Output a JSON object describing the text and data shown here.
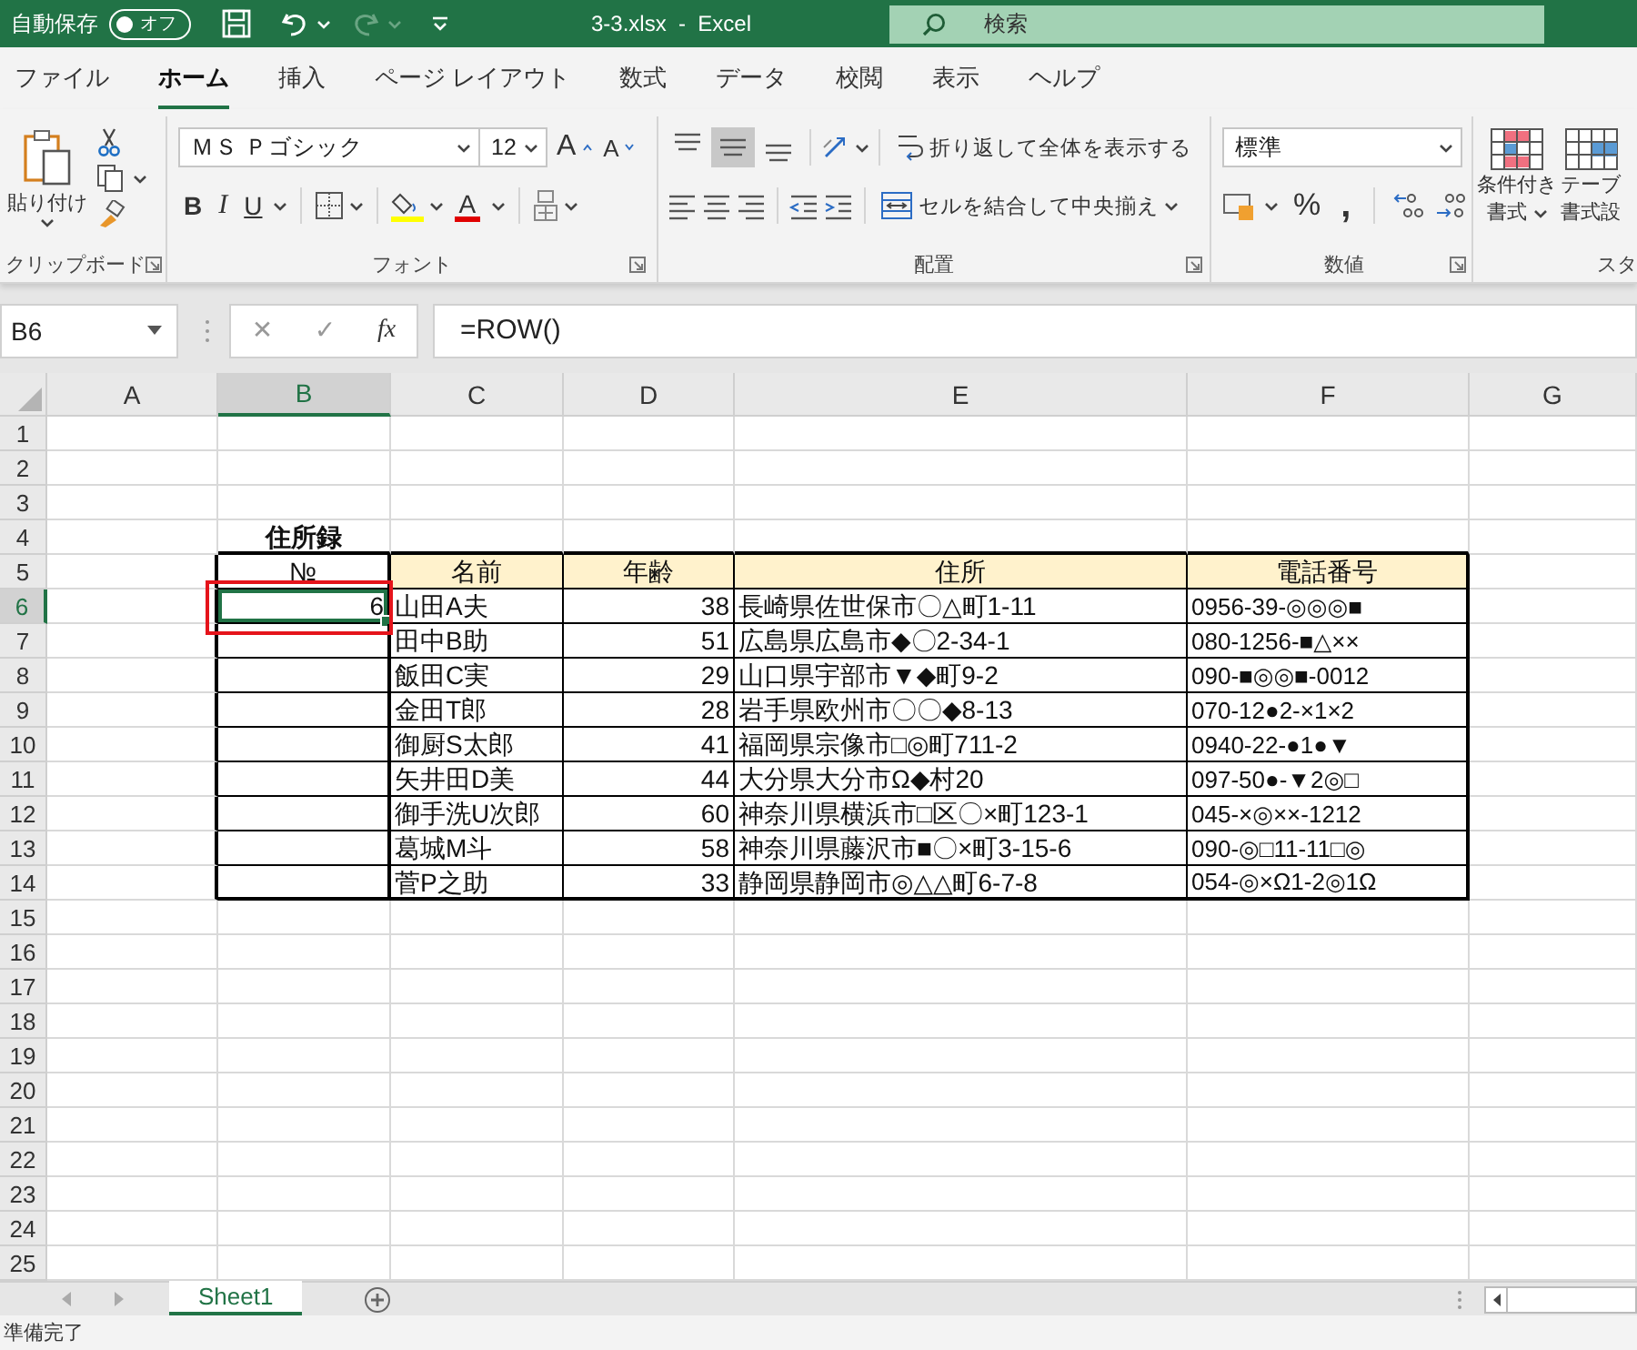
{
  "title_bar": {
    "autosave": {
      "label": "自動保存",
      "toggle": "オフ",
      "on": false
    },
    "title": "3-3.xlsx  -  Excel",
    "search": {
      "placeholder": "検索"
    }
  },
  "menu_tabs": [
    {
      "label": "ファイル",
      "selected": false
    },
    {
      "label": "ホーム",
      "selected": true
    },
    {
      "label": "挿入",
      "selected": false
    },
    {
      "label": "ページ レイアウト",
      "selected": false
    },
    {
      "label": "数式",
      "selected": false
    },
    {
      "label": "データ",
      "selected": false
    },
    {
      "label": "校閲",
      "selected": false
    },
    {
      "label": "表示",
      "selected": false
    },
    {
      "label": "ヘルプ",
      "selected": false
    }
  ],
  "ribbon": {
    "clipboard": {
      "paste": "貼り付け",
      "label": "クリップボード"
    },
    "font": {
      "font_name": "ＭＳ Ｐゴシック",
      "font_size": "12",
      "grow": "A",
      "shrink": "A",
      "bold": "B",
      "italic": "I",
      "underline": "U",
      "font_color": "A",
      "label": "フォント"
    },
    "alignment": {
      "vertical": [
        {
          "selected": false
        },
        {
          "selected": true
        },
        {
          "selected": false
        }
      ],
      "wrap_text": "折り返して全体を表示する",
      "merge": "セルを結合して中央揃え",
      "label": "配置"
    },
    "number": {
      "format": "標準",
      "percent": "%",
      "comma": ",",
      "label": "数値"
    },
    "styles": {
      "conditional_formatting": [
        "条件付き",
        "書式"
      ],
      "format_as_table": [
        "テーブ",
        "書式設"
      ],
      "label": "スタ"
    }
  },
  "formula_bar": {
    "name_box": "B6",
    "cancel": "✕",
    "enter": "✓",
    "function": "fx",
    "formula": "=ROW()"
  },
  "sheet": {
    "columns": [
      {
        "label": "A",
        "selected": false
      },
      {
        "label": "B",
        "selected": true
      },
      {
        "label": "C",
        "selected": false
      },
      {
        "label": "D",
        "selected": false
      },
      {
        "label": "E",
        "selected": false
      },
      {
        "label": "F",
        "selected": false
      },
      {
        "label": "G",
        "selected": false
      }
    ],
    "rows": [
      {
        "label": "1",
        "selected": false
      },
      {
        "label": "2",
        "selected": false
      },
      {
        "label": "3",
        "selected": false
      },
      {
        "label": "4",
        "selected": false
      },
      {
        "label": "5",
        "selected": false
      },
      {
        "label": "6",
        "selected": true
      },
      {
        "label": "7",
        "selected": false
      },
      {
        "label": "8",
        "selected": false
      },
      {
        "label": "9",
        "selected": false
      },
      {
        "label": "10",
        "selected": false
      },
      {
        "label": "11",
        "selected": false
      },
      {
        "label": "12",
        "selected": false
      },
      {
        "label": "13",
        "selected": false
      },
      {
        "label": "14",
        "selected": false
      },
      {
        "label": "15",
        "selected": false
      },
      {
        "label": "16",
        "selected": false
      },
      {
        "label": "17",
        "selected": false
      },
      {
        "label": "18",
        "selected": false
      },
      {
        "label": "19",
        "selected": false
      },
      {
        "label": "20",
        "selected": false
      },
      {
        "label": "21",
        "selected": false
      },
      {
        "label": "22",
        "selected": false
      },
      {
        "label": "23",
        "selected": false
      },
      {
        "label": "24",
        "selected": false
      },
      {
        "label": "25",
        "selected": false
      }
    ],
    "title": "住所録",
    "table": {
      "columns": [
        "№",
        "名前",
        "年齢",
        "住所",
        "電話番号"
      ],
      "rows": [
        {
          "no": "6",
          "name": "山田A夫",
          "age": "38",
          "address": "長崎県佐世保市〇△町1-11",
          "phone": "0956-39-◎◎◎■",
          "selected": true,
          "highlighted": true
        },
        {
          "name": "田中B助",
          "age": "51",
          "address": "広島県広島市◆〇2-34-1",
          "phone": "080-1256-■△××",
          "selected": false,
          "highlighted": false
        },
        {
          "name": "飯田C実",
          "age": "29",
          "address": "山口県宇部市▼◆町9-2",
          "phone": "090-■◎◎■-0012",
          "selected": false,
          "highlighted": false
        },
        {
          "name": "金田T郎",
          "age": "28",
          "address": "岩手県欧州市〇〇◆8-13",
          "phone": "070-12●2-×1×2",
          "selected": false,
          "highlighted": false
        },
        {
          "name": "御厨S太郎",
          "age": "41",
          "address": "福岡県宗像市□◎町711-2",
          "phone": "0940-22-●1●▼",
          "selected": false,
          "highlighted": false
        },
        {
          "name": "矢井田D美",
          "age": "44",
          "address": "大分県大分市Ω◆村20",
          "phone": "097-50●-▼2◎□",
          "selected": false,
          "highlighted": false
        },
        {
          "name": "御手洗U次郎",
          "age": "60",
          "address": "神奈川県横浜市□区〇×町123-1",
          "phone": "045-×◎××-1212",
          "selected": false,
          "highlighted": false
        },
        {
          "name": "葛城M斗",
          "age": "58",
          "address": "神奈川県藤沢市■〇×町3-15-6",
          "phone": "090-◎□11-11□◎",
          "selected": false,
          "highlighted": false
        },
        {
          "name": "菅P之助",
          "age": "33",
          "address": "静岡県静岡市◎△△町6-7-8",
          "phone": "054-◎×Ω1-2◎1Ω",
          "selected": false,
          "highlighted": false
        }
      ]
    }
  },
  "sheet_tabs": [
    {
      "label": "Sheet1",
      "selected": true
    }
  ],
  "status_bar": {
    "text": "準備完了"
  }
}
